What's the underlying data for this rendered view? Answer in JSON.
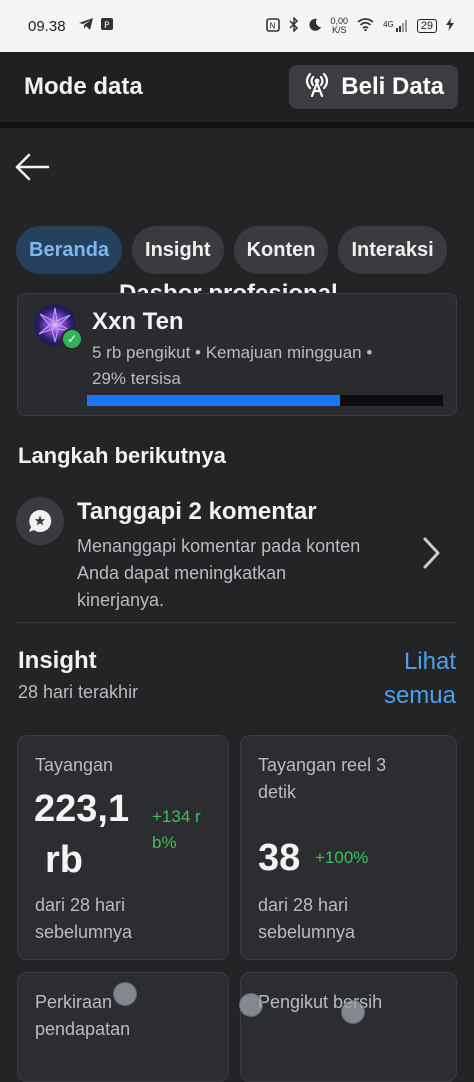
{
  "status_bar": {
    "time": "09.38",
    "net_speed_value": "0,00",
    "net_speed_unit": "K/S",
    "network": "4G",
    "battery": "29"
  },
  "data_bar": {
    "title": "Mode data",
    "buy_label": "Beli Data"
  },
  "header": {
    "title": "Dasbor profesional"
  },
  "tabs": [
    {
      "label": "Beranda",
      "active": true
    },
    {
      "label": "Insight",
      "active": false
    },
    {
      "label": "Konten",
      "active": false
    },
    {
      "label": "Interaksi",
      "active": false
    }
  ],
  "profile": {
    "name": "Xxn Ten",
    "meta_line1": "5 rb pengikut • Kemajuan mingguan •",
    "meta_line2": "29% tersisa",
    "weekly_progress_fraction": 0.71
  },
  "next_steps": {
    "title": "Langkah berikutnya",
    "item_title": "Tanggapi 2 komentar",
    "item_desc_1": "Menanggapi komentar pada konten",
    "item_desc_2": "Anda dapat meningkatkan",
    "item_desc_3": "kinerjanya."
  },
  "insight": {
    "title": "Insight",
    "subtitle": "28 hari terakhir",
    "see_all_1": "Lihat",
    "see_all_2": "semua",
    "cards": [
      {
        "label_1": "Tayangan",
        "value_1": "223,1",
        "value_2": "rb",
        "delta_1": "+134 r",
        "delta_2": "b%",
        "foot_1": "dari 28 hari",
        "foot_2": "sebelumnya"
      },
      {
        "label_1": "Tayangan reel 3",
        "label_2": "detik",
        "value_1": "38",
        "delta_1": "+100%",
        "foot_1": "dari 28 hari",
        "foot_2": "sebelumnya"
      },
      {
        "label_1": "Perkiraan",
        "label_2": "pendapatan"
      },
      {
        "label_1": "Pengikut bersih"
      }
    ]
  }
}
